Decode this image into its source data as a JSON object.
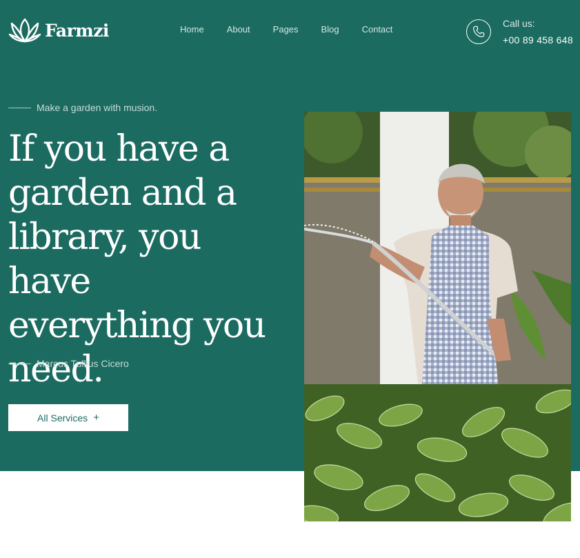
{
  "brand": {
    "name": "Farmzi"
  },
  "nav": {
    "items": [
      "Home",
      "About",
      "Pages",
      "Blog",
      "Contact"
    ]
  },
  "contact": {
    "label": "Call us:",
    "phone": "+00 89 458 648"
  },
  "hero": {
    "tagline": "Make a garden with musion.",
    "headline": [
      "If you have a",
      "garden and a",
      "library, you have",
      "everything you",
      "need."
    ],
    "author": "Marcus Tullius Cicero",
    "button_label": "All Services",
    "button_icon": "+"
  },
  "colors": {
    "brand_green": "#1b6b61",
    "white": "#ffffff"
  },
  "icons": {
    "logo": "lotus-icon",
    "phone": "phone-icon"
  }
}
